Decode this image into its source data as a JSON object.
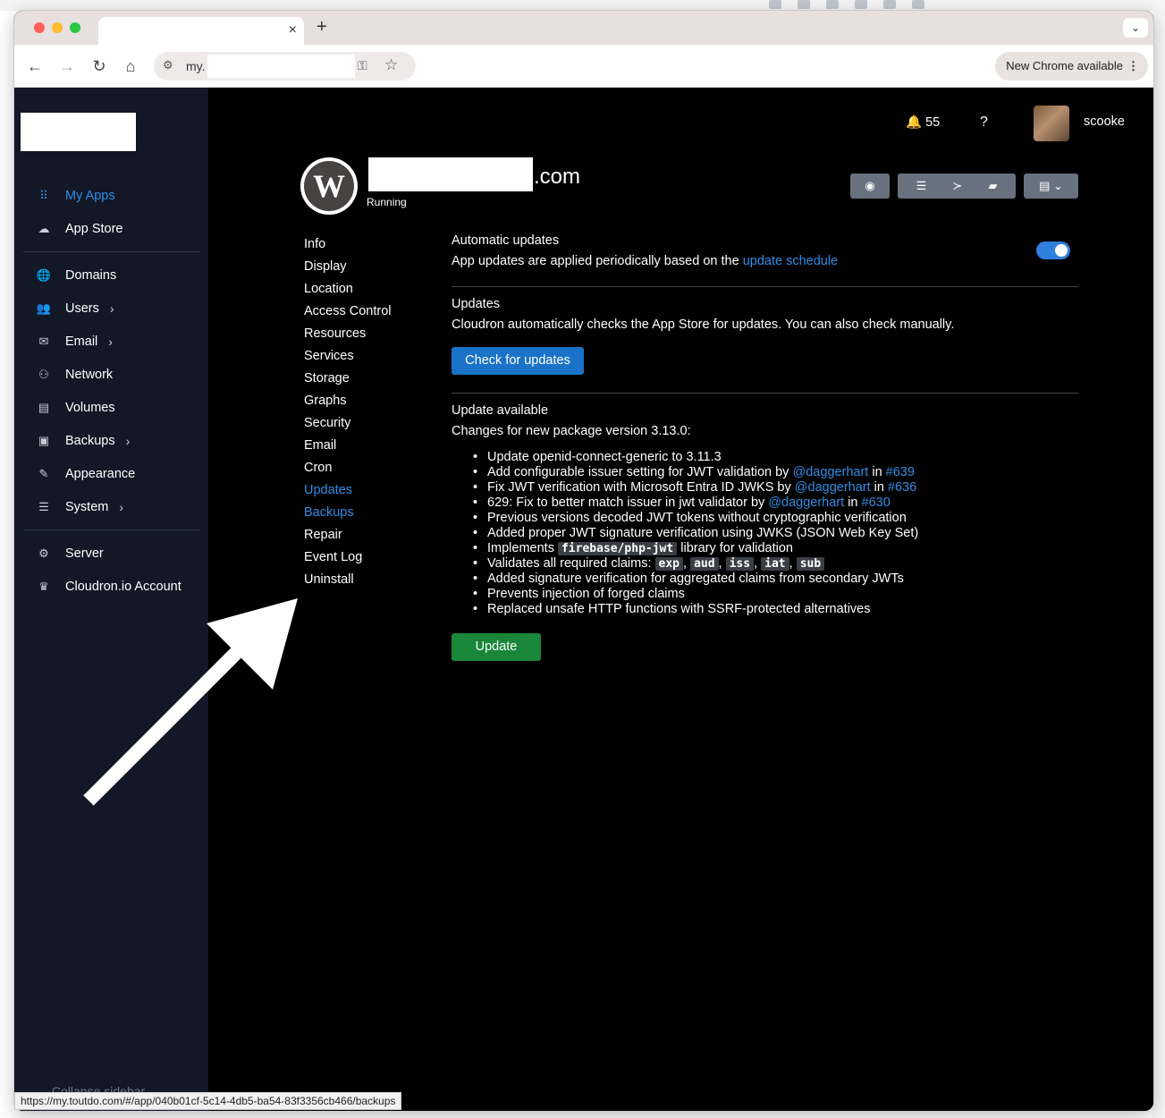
{
  "browser": {
    "tab_close": "×",
    "new_tab": "+",
    "tab_menu": "⌄",
    "url_prefix": "my.",
    "chrome_update": "New Chrome available",
    "status_url": "https://my.toutdo.com/#/app/040b01cf-5c14-4db5-ba54-83f3356cb466/backups"
  },
  "sidebar": {
    "items": [
      {
        "label": "My Apps",
        "icon": "grid-icon",
        "glyph": "⠿"
      },
      {
        "label": "App Store",
        "icon": "cloud-download-icon",
        "glyph": "☁"
      },
      {
        "label": "Domains",
        "icon": "globe-icon",
        "glyph": "🌐"
      },
      {
        "label": "Users",
        "icon": "users-icon",
        "glyph": "👥"
      },
      {
        "label": "Email",
        "icon": "envelope-icon",
        "glyph": "✉"
      },
      {
        "label": "Network",
        "icon": "network-icon",
        "glyph": "⚇"
      },
      {
        "label": "Volumes",
        "icon": "hdd-icon",
        "glyph": "▤"
      },
      {
        "label": "Backups",
        "icon": "archive-icon",
        "glyph": "▣"
      },
      {
        "label": "Appearance",
        "icon": "paint-brush-icon",
        "glyph": "✎"
      },
      {
        "label": "System",
        "icon": "server-icon",
        "glyph": "☰"
      },
      {
        "label": "Server",
        "icon": "chip-icon",
        "glyph": "⚙"
      },
      {
        "label": "Cloudron.io Account",
        "icon": "crown-icon",
        "glyph": "♛"
      }
    ],
    "collapse": "Collapse sidebar",
    "chevron": "›"
  },
  "header": {
    "notifications": "55",
    "help": "?",
    "username": "scooke"
  },
  "app": {
    "title_suffix": ".com",
    "status": "Running",
    "logo_letter": "W"
  },
  "subnav": [
    "Info",
    "Display",
    "Location",
    "Access Control",
    "Resources",
    "Services",
    "Storage",
    "Graphs",
    "Security",
    "Email",
    "Cron",
    "Updates",
    "Backups",
    "Repair",
    "Event Log",
    "Uninstall"
  ],
  "auto_updates": {
    "title": "Automatic updates",
    "text": "App updates are applied periodically based on the ",
    "link": "update schedule",
    "enabled": true
  },
  "updates": {
    "title": "Updates",
    "text": "Cloudron automatically checks the App Store for updates. You can also check manually.",
    "button": "Check for updates"
  },
  "update_available": {
    "title": "Update available",
    "subtitle": "Changes for new package version 3.13.0:",
    "items": {
      "i1": "Update openid-connect-generic to 3.11.3",
      "i2_a": "Add configurable issuer setting for JWT validation by ",
      "i2_user": "@daggerhart",
      "i2_in": " in ",
      "i2_ref": "#639",
      "i3_a": "Fix JWT verification with Microsoft Entra ID JWKS by ",
      "i3_user": "@daggerhart",
      "i3_in": " in ",
      "i3_ref": "#636",
      "i4_a": "629: Fix to better match issuer in jwt validator by ",
      "i4_user": "@daggerhart",
      "i4_in": " in ",
      "i4_ref": "#630",
      "i5": "Previous versions decoded JWT tokens without cryptographic verification",
      "i6": "Added proper JWT signature verification using JWKS (JSON Web Key Set)",
      "i7_a": "Implements ",
      "i7_code": "firebase/php-jwt",
      "i7_b": " library for validation",
      "i8_a": "Validates all required claims: ",
      "i8_c1": "exp",
      "i8_c2": "aud",
      "i8_c3": "iss",
      "i8_c4": "iat",
      "i8_c5": "sub",
      "i9": "Added signature verification for aggregated claims from secondary JWTs",
      "i10": "Prevents injection of forged claims",
      "i11": "Replaced unsafe HTTP functions with SSRF-protected alternatives"
    },
    "button": "Update"
  }
}
